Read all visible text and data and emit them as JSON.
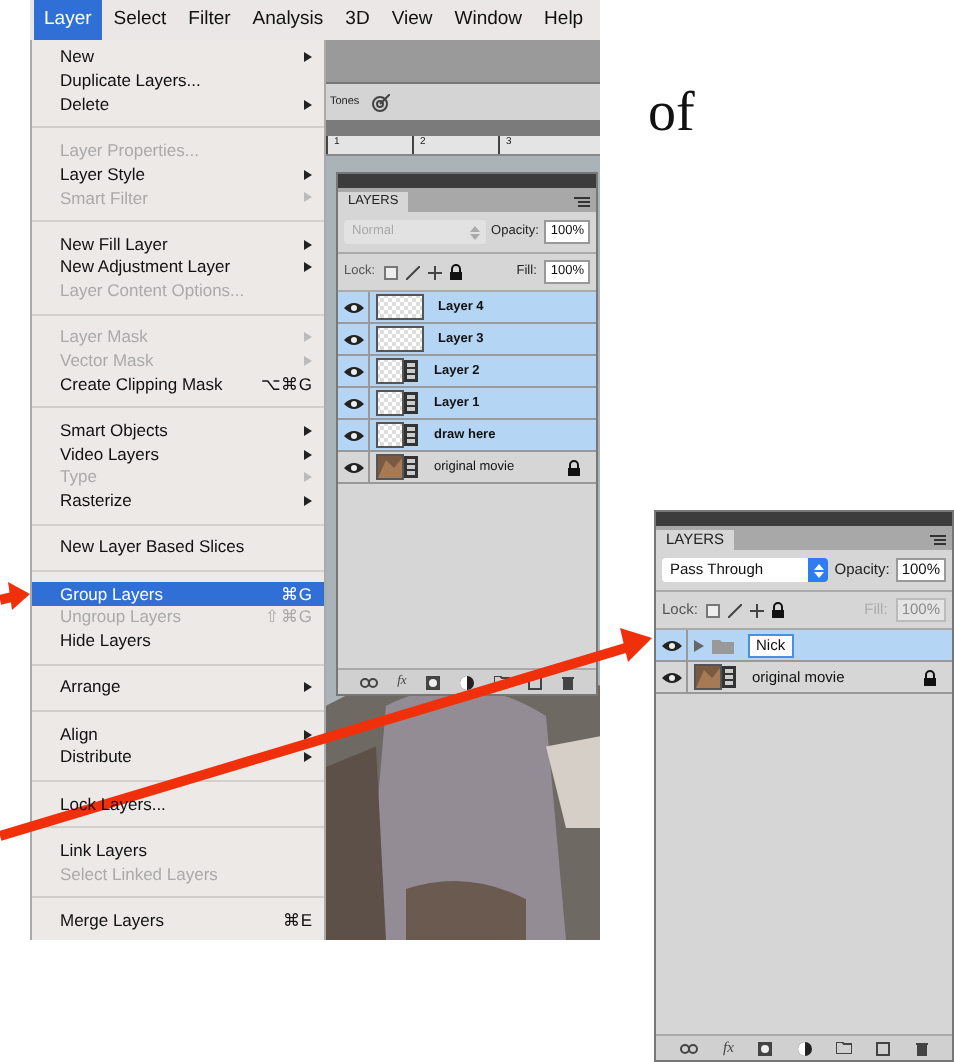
{
  "menu_bar": [
    {
      "label": "Layer",
      "selected": true
    },
    {
      "label": "Select",
      "selected": false
    },
    {
      "label": "Filter",
      "selected": false
    },
    {
      "label": "Analysis",
      "selected": false
    },
    {
      "label": "3D",
      "selected": false
    },
    {
      "label": "View",
      "selected": false
    },
    {
      "label": "Window",
      "selected": false
    },
    {
      "label": "Help",
      "selected": false
    }
  ],
  "layer_menu": {
    "groups": [
      {
        "items": [
          {
            "label": "New",
            "disabled": false,
            "submenu": true,
            "selected": false
          },
          {
            "label": "Duplicate Layers...",
            "disabled": false,
            "submenu": false,
            "selected": false
          },
          {
            "label": "Delete",
            "disabled": false,
            "submenu": true,
            "selected": false
          }
        ]
      },
      {
        "items": [
          {
            "label": "Layer Properties...",
            "disabled": true,
            "submenu": false,
            "selected": false
          },
          {
            "label": "Layer Style",
            "disabled": false,
            "submenu": true,
            "selected": false
          },
          {
            "label": "Smart Filter",
            "disabled": true,
            "submenu": true,
            "selected": false
          }
        ]
      },
      {
        "items": [
          {
            "label": "New Fill Layer",
            "disabled": false,
            "submenu": true,
            "selected": false
          },
          {
            "label": "New Adjustment Layer",
            "disabled": false,
            "submenu": true,
            "selected": false
          },
          {
            "label": "Layer Content Options...",
            "disabled": true,
            "submenu": false,
            "selected": false
          }
        ]
      },
      {
        "items": [
          {
            "label": "Layer Mask",
            "disabled": true,
            "submenu": true,
            "selected": false
          },
          {
            "label": "Vector Mask",
            "disabled": true,
            "submenu": true,
            "selected": false
          },
          {
            "label": "Create Clipping Mask",
            "disabled": false,
            "submenu": false,
            "selected": false,
            "shortcut": "⌥⌘G"
          }
        ]
      },
      {
        "items": [
          {
            "label": "Smart Objects",
            "disabled": false,
            "submenu": true,
            "selected": false
          },
          {
            "label": "Video Layers",
            "disabled": false,
            "submenu": true,
            "selected": false
          },
          {
            "label": "Type",
            "disabled": true,
            "submenu": true,
            "selected": false
          },
          {
            "label": "Rasterize",
            "disabled": false,
            "submenu": true,
            "selected": false
          }
        ]
      },
      {
        "items": [
          {
            "label": "New Layer Based Slices",
            "disabled": false,
            "submenu": false,
            "selected": false
          }
        ]
      },
      {
        "items": [
          {
            "label": "Group Layers",
            "disabled": false,
            "submenu": false,
            "selected": true,
            "shortcut": "⌘G"
          },
          {
            "label": "Ungroup Layers",
            "disabled": true,
            "submenu": false,
            "selected": false,
            "shortcut": "⇧⌘G"
          },
          {
            "label": "Hide Layers",
            "disabled": false,
            "submenu": false,
            "selected": false
          }
        ]
      },
      {
        "items": [
          {
            "label": "Arrange",
            "disabled": false,
            "submenu": true,
            "selected": false
          }
        ]
      },
      {
        "items": [
          {
            "label": "Align",
            "disabled": false,
            "submenu": true,
            "selected": false
          },
          {
            "label": "Distribute",
            "disabled": false,
            "submenu": true,
            "selected": false
          }
        ]
      },
      {
        "items": [
          {
            "label": "Lock Layers...",
            "disabled": false,
            "submenu": false,
            "selected": false
          }
        ]
      },
      {
        "items": [
          {
            "label": "Link Layers",
            "disabled": false,
            "submenu": false,
            "selected": false
          },
          {
            "label": "Select Linked Layers",
            "disabled": true,
            "submenu": false,
            "selected": false
          }
        ]
      },
      {
        "items": [
          {
            "label": "Merge Layers",
            "disabled": false,
            "submenu": false,
            "selected": false,
            "shortcut": "⌘E"
          }
        ]
      }
    ]
  },
  "options_bar": {
    "label": "Tones"
  },
  "ruler": {
    "marks": [
      "1",
      "2",
      "3"
    ]
  },
  "layers_panel_before": {
    "tab": "LAYERS",
    "blend_mode": "Normal",
    "blend_disabled": true,
    "opacity_label": "Opacity:",
    "opacity": "100%",
    "lock_label": "Lock:",
    "fill_label": "Fill:",
    "fill": "100%",
    "fill_disabled": false,
    "effects_label": "fx",
    "layers": [
      {
        "name": "Layer 4",
        "kind": "blank_layer",
        "selected": true,
        "locked": false,
        "visible": true
      },
      {
        "name": "Layer 3",
        "kind": "blank_layer",
        "selected": true,
        "locked": false,
        "visible": true
      },
      {
        "name": "Layer 2",
        "kind": "video_layer",
        "selected": true,
        "locked": false,
        "visible": true
      },
      {
        "name": "Layer 1",
        "kind": "video_layer",
        "selected": true,
        "locked": false,
        "visible": true
      },
      {
        "name": "draw here",
        "kind": "video_layer",
        "selected": true,
        "locked": false,
        "visible": true
      },
      {
        "name": "original movie",
        "kind": "movie_layer",
        "selected": false,
        "locked": true,
        "visible": true
      }
    ]
  },
  "caption": "of",
  "layers_panel_after": {
    "tab": "LAYERS",
    "blend_mode": "Pass Through",
    "blend_disabled": false,
    "opacity_label": "Opacity:",
    "opacity": "100%",
    "lock_label": "Lock:",
    "fill_label": "Fill:",
    "fill": "100%",
    "fill_disabled": true,
    "effects_label": "fx",
    "layers": [
      {
        "name": "Nick",
        "kind": "group",
        "selected": true,
        "locked": false,
        "visible": true,
        "editing": true
      },
      {
        "name": "original movie",
        "kind": "movie_layer",
        "selected": false,
        "locked": true,
        "visible": true
      }
    ]
  }
}
